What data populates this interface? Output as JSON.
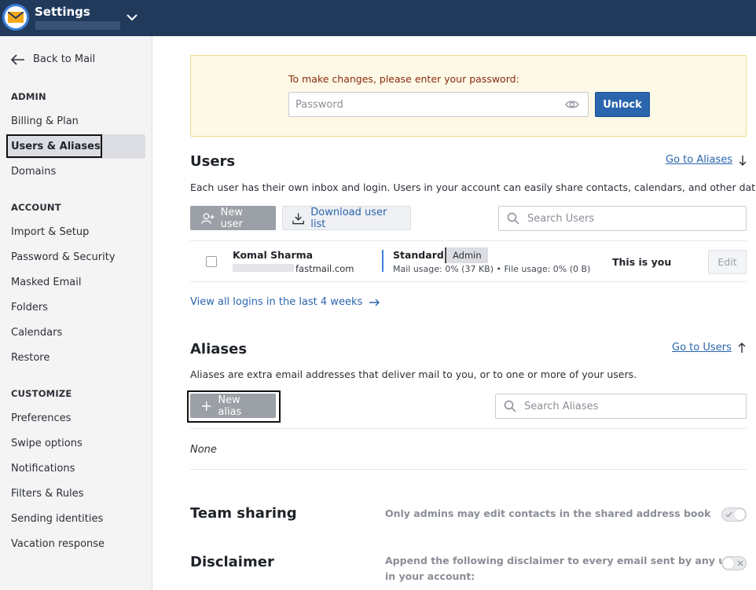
{
  "header": {
    "app_title": "Settings"
  },
  "sidebar": {
    "back_label": "Back to Mail",
    "sections": [
      {
        "title": "ADMIN",
        "items": [
          "Billing & Plan",
          "Users & Aliases",
          "Domains"
        ]
      },
      {
        "title": "ACCOUNT",
        "items": [
          "Import & Setup",
          "Password & Security",
          "Masked Email",
          "Folders",
          "Calendars",
          "Restore"
        ]
      },
      {
        "title": "CUSTOMIZE",
        "items": [
          "Preferences",
          "Swipe options",
          "Notifications",
          "Filters & Rules",
          "Sending identities",
          "Vacation response"
        ]
      }
    ],
    "selected": "Users & Aliases"
  },
  "lock": {
    "title": "To make changes, please enter your password:",
    "password_placeholder": "Password",
    "unlock_label": "Unlock"
  },
  "users": {
    "heading": "Users",
    "goto_label": "Go to Aliases",
    "description": "Each user has their own inbox and login. Users in your account can easily share contacts, calendars, and other data.",
    "new_user_label": "New user",
    "download_label": "Download user list",
    "search_placeholder": "Search Users",
    "rows": [
      {
        "name": "Komal Sharma",
        "email_suffix": "fastmail.com",
        "plan": "Standard",
        "role": "Admin",
        "usage": "Mail usage: 0% (37 KB) • File usage: 0% (0 B)",
        "note": "This is you",
        "edit_label": "Edit"
      }
    ],
    "view_logins_label": "View all logins in the last 4 weeks"
  },
  "aliases": {
    "heading": "Aliases",
    "goto_label": "Go to Users",
    "description": "Aliases are extra email addresses that deliver mail to you, or to one or more of your users.",
    "new_alias_label": "New alias",
    "search_placeholder": "Search Aliases",
    "empty_label": "None"
  },
  "team_sharing": {
    "heading": "Team sharing",
    "text": "Only admins may edit contacts in the shared address book",
    "enabled": true
  },
  "disclaimer": {
    "heading": "Disclaimer",
    "text_1": "Append the following disclaimer to every email sent by any user",
    "text_2": "in your account:",
    "enabled": false
  },
  "colors": {
    "topbar": "#213a5c",
    "accent": "#2a65ad",
    "warning_bg": "#fdf9e6"
  }
}
